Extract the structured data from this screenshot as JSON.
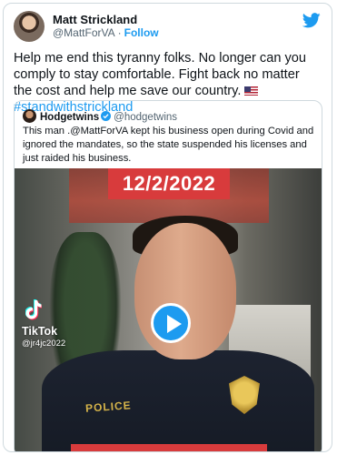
{
  "tweet": {
    "author": {
      "name": "Matt Strickland",
      "handle": "@MattForVA",
      "separator": "·",
      "follow_label": "Follow"
    },
    "text": "Help me end this tyranny folks. No longer can you comply to stay comfortable. Fight back no matter the cost and help me save our country.",
    "hashtag": "#standwithstrickland"
  },
  "quoted_tweet": {
    "author": {
      "name": "Hodgetwins",
      "handle": "@hodgetwins",
      "verified": true
    },
    "text": "This man .@MattForVA kept his business open during Covid and ignored the mandates, so the state suspended his licenses and just raided his business.",
    "video": {
      "date_overlay": "12/2/2022",
      "watermark_name": "TikTok",
      "watermark_user": "@jr4jc2022",
      "uniform_text": "POLICE"
    }
  },
  "icons": [
    "twitter-bird-icon",
    "us-flag-icon",
    "verified-badge-icon",
    "tiktok-icon",
    "play-icon"
  ],
  "colors": {
    "accent": "#1d9bf0",
    "text": "#0f1419",
    "secondary_text": "#536471",
    "border": "#cfd9de",
    "overlay_red": "#d83b3c"
  }
}
